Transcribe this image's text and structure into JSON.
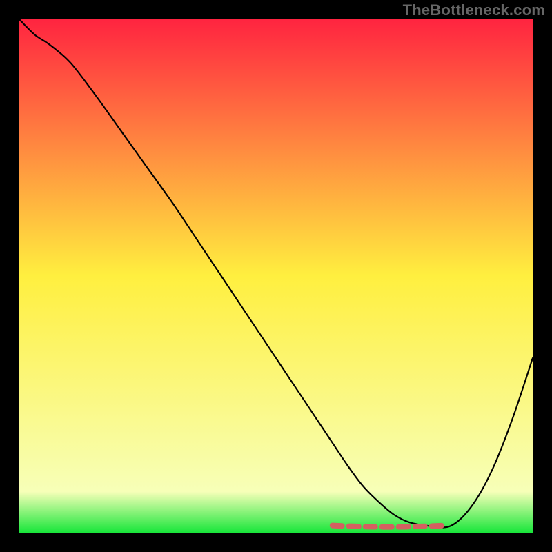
{
  "watermark": "TheBottleneck.com",
  "gradient": {
    "stops": [
      {
        "offset": "0%",
        "color": "#ff2440"
      },
      {
        "offset": "50%",
        "color": "#ffef3f"
      },
      {
        "offset": "92%",
        "color": "#f7ffb8"
      },
      {
        "offset": "100%",
        "color": "#18e63a"
      }
    ]
  },
  "chart_data": {
    "type": "line",
    "title": "",
    "xlabel": "",
    "ylabel": "",
    "xlim": [
      0,
      100
    ],
    "ylim": [
      0,
      100
    ],
    "x": [
      0,
      3,
      6,
      10,
      15,
      20,
      25,
      30,
      35,
      40,
      45,
      50,
      55,
      58,
      61,
      64,
      67,
      70,
      73,
      76,
      80,
      84,
      88,
      92,
      96,
      100
    ],
    "values": [
      100,
      97,
      95,
      91.5,
      85,
      78,
      71,
      64,
      56.5,
      49,
      41.5,
      34,
      26.5,
      22,
      17.5,
      13,
      9,
      6,
      3.5,
      2,
      1.3,
      1.3,
      5,
      12,
      22,
      34
    ],
    "highlight_range_x": [
      61,
      83
    ],
    "highlight_y": 1.4,
    "annotations": []
  }
}
